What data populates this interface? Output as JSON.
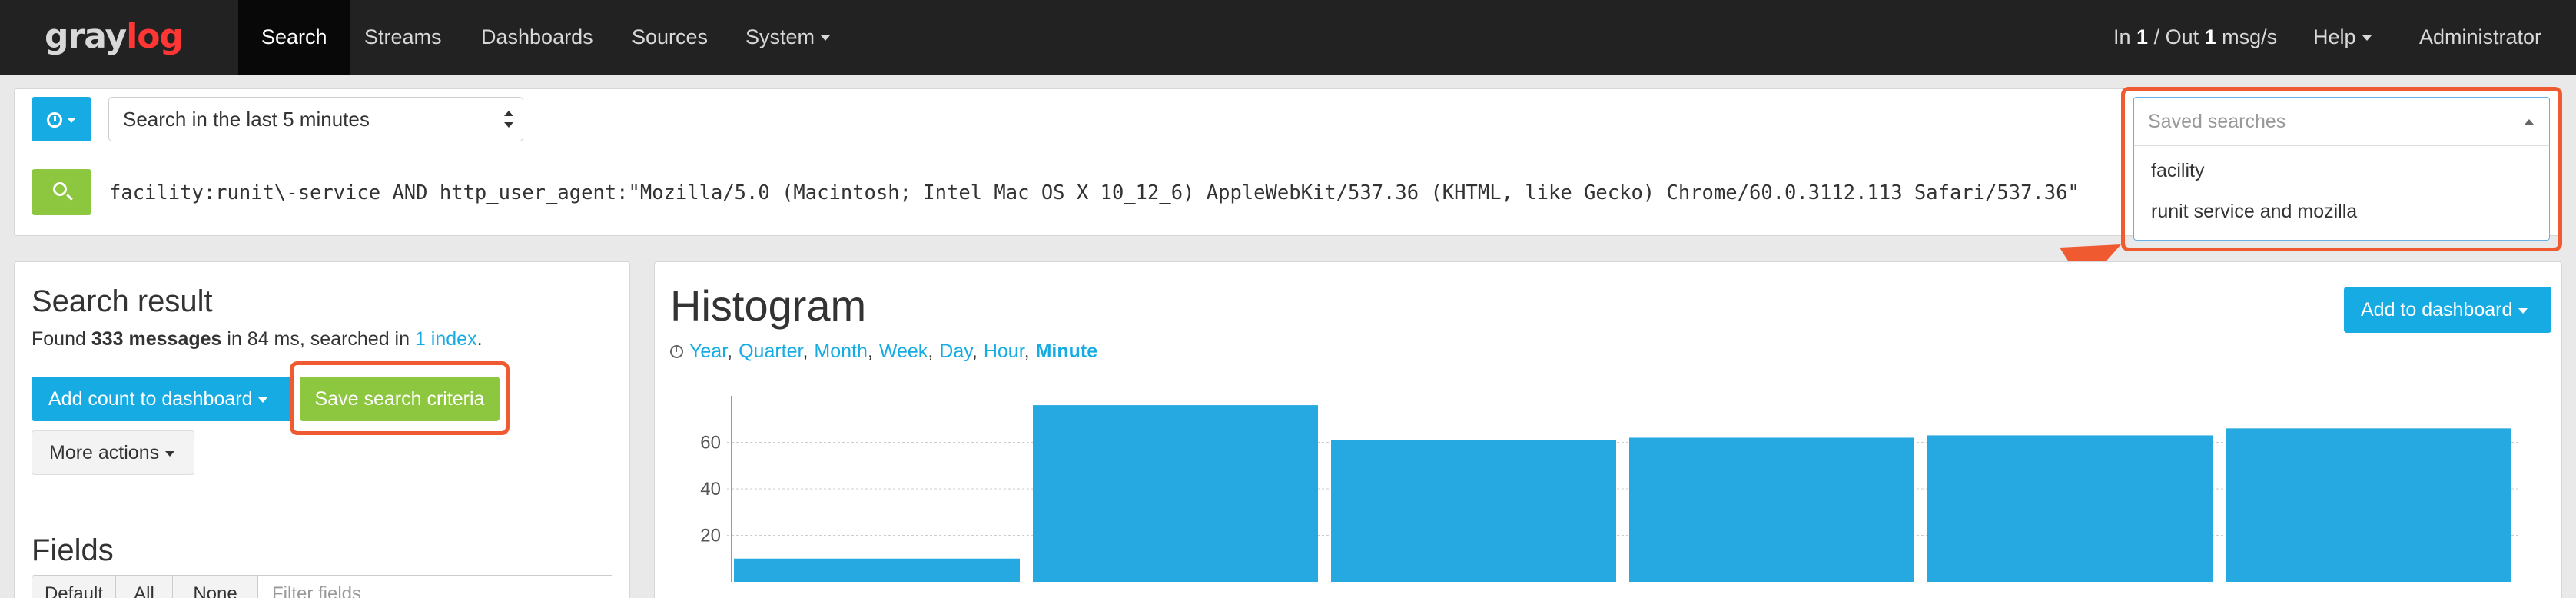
{
  "navbar": {
    "logo_part1": "gray",
    "logo_part2": "log",
    "items": [
      "Search",
      "Streams",
      "Dashboards",
      "Sources",
      "System"
    ],
    "throughput_in_label": "In ",
    "throughput_in": "1",
    "throughput_sep": " / Out ",
    "throughput_out": "1",
    "throughput_unit": " msg/s",
    "help": "Help",
    "user": "Administrator"
  },
  "search": {
    "range": "Search in the last 5 minutes",
    "query": "facility:runit\\-service AND http_user_agent:\"Mozilla/5.0 (Macintosh; Intel Mac OS X 10_12_6) AppleWebKit/537.36 (KHTML, like Gecko) Chrome/60.0.3112.113 Safari/537.36\""
  },
  "saved_searches": {
    "placeholder": "Saved searches",
    "options": [
      "facility",
      "runit service and mozilla"
    ]
  },
  "result": {
    "title": "Search result",
    "found_prefix": "Found ",
    "count": "333 messages",
    "time_text": " in 84 ms, searched in ",
    "index_link": "1 index",
    "period": ".",
    "add_count_label": "Add count to dashboard",
    "save_label": "Save search criteria",
    "more_actions_label": "More actions"
  },
  "fields": {
    "title": "Fields",
    "buttons": [
      "Default",
      "All",
      "None"
    ],
    "filter_placeholder": "Filter fields"
  },
  "histogram": {
    "title": "Histogram",
    "resolutions": [
      "Year",
      "Quarter",
      "Month",
      "Week",
      "Day",
      "Hour",
      "Minute"
    ],
    "active_resolution": "Minute",
    "add_to_dashboard_label": "Add to dashboard"
  },
  "colors": {
    "accent": "#16ace3",
    "success": "#8dc63f",
    "annotation": "#f05a30",
    "navbar": "#222222"
  },
  "chart_data": {
    "type": "bar",
    "ylim": [
      0,
      80
    ],
    "yticks": [
      20,
      40,
      60
    ],
    "values": [
      10,
      76,
      61,
      62,
      63,
      66
    ]
  }
}
